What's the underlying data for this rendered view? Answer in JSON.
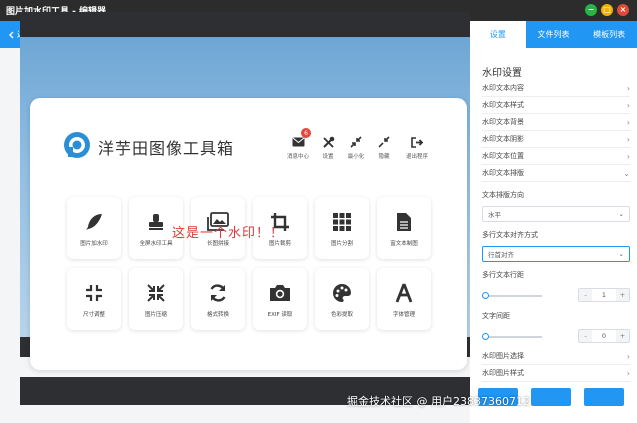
{
  "window": {
    "title": "图片加水印工具 - 编辑器",
    "controls": {
      "minimize": "−",
      "maximize": "□",
      "close": "×"
    }
  },
  "toolbar": {
    "back_label": "返回",
    "back_icon": "chevron-left-icon"
  },
  "tabs": [
    {
      "label": "设置",
      "active": true
    },
    {
      "label": "文件列表",
      "active": false
    },
    {
      "label": "模板列表",
      "active": false
    }
  ],
  "preview": {
    "brand_name": "洋芋田图像工具箱",
    "watermark_text": "这是一个水印！！",
    "header_actions": [
      {
        "label": "消息中心",
        "icon": "envelope-icon",
        "badge": "6"
      },
      {
        "label": "设置",
        "icon": "tools-icon"
      },
      {
        "label": "最小化",
        "icon": "compress-icon"
      },
      {
        "label": "隐藏",
        "icon": "hide-icon"
      },
      {
        "label": "退出程序",
        "icon": "sign-out-icon"
      }
    ],
    "tools": [
      {
        "label": "图片加水印",
        "icon": "feather-icon"
      },
      {
        "label": "全屏水印工具",
        "icon": "stamp-icon"
      },
      {
        "label": "长图拼接",
        "icon": "images-icon"
      },
      {
        "label": "图片裁剪",
        "icon": "crop-icon"
      },
      {
        "label": "图片分割",
        "icon": "grid-icon"
      },
      {
        "label": "富文本制图",
        "icon": "document-icon"
      },
      {
        "label": "尺寸调整",
        "icon": "expand-icon"
      },
      {
        "label": "图片压缩",
        "icon": "compress-arrows-icon"
      },
      {
        "label": "格式转换",
        "icon": "sync-icon"
      },
      {
        "label": "EXIF 读取",
        "icon": "camera-icon"
      },
      {
        "label": "色彩提取",
        "icon": "palette-icon"
      },
      {
        "label": "字体管理",
        "icon": "font-icon"
      }
    ]
  },
  "panel": {
    "title": "水印设置",
    "sections": [
      {
        "label": "水印文本内容"
      },
      {
        "label": "水印文本样式"
      },
      {
        "label": "水印文本背景"
      },
      {
        "label": "水印文本阴影"
      },
      {
        "label": "水印文本位置"
      },
      {
        "label": "水印文本排版"
      }
    ],
    "layout_direction": {
      "label": "文本排版方向",
      "value": "水平"
    },
    "alignment": {
      "label": "多行文本对齐方式",
      "value": "行首对齐"
    },
    "line_spacing": {
      "label": "多行文本行距",
      "value": "1",
      "minus": "-",
      "plus": "+"
    },
    "letter_spacing": {
      "label": "文字间距",
      "value": "0",
      "minus": "-",
      "plus": "+"
    },
    "more_sections": [
      {
        "label": "水印图片选择"
      },
      {
        "label": "水印图片样式"
      }
    ]
  },
  "footer_credit": "掘金技术社区 @ 用户2383736071​2",
  "colors": {
    "accent": "#2196f3",
    "titlebar": "#2c2c2c",
    "watermark": "#e0393a",
    "badge": "#e8443a"
  }
}
